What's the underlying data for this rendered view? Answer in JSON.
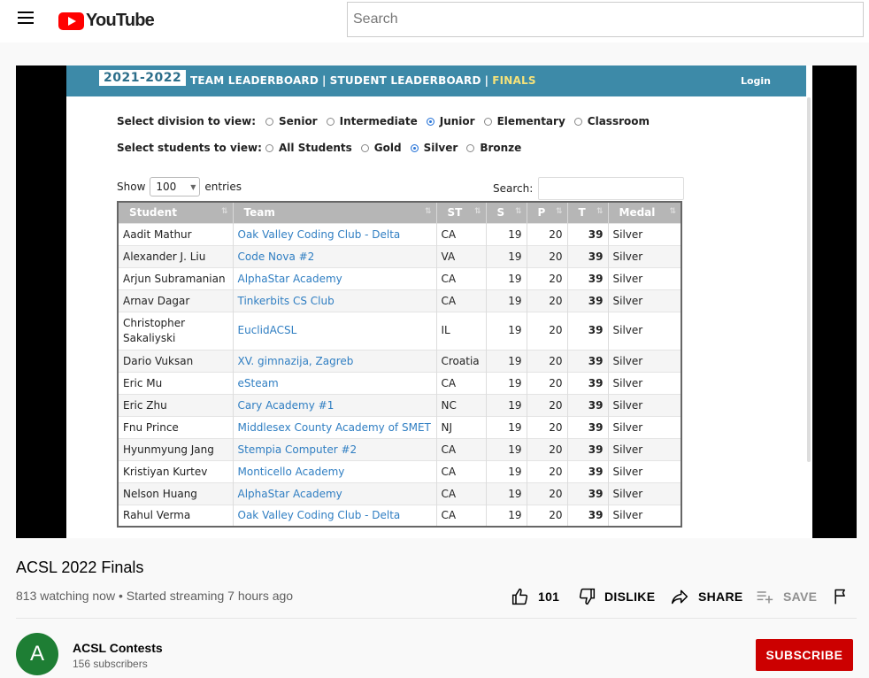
{
  "header": {
    "logo_text": "YouTube",
    "search_placeholder": "Search"
  },
  "video": {
    "acsl": {
      "year": "2021-2022",
      "nav": [
        "TEAM LEADERBOARD",
        "STUDENT LEADERBOARD",
        "FINALS"
      ],
      "login": "Login",
      "division_label": "Select division to view:",
      "divisions": [
        "Senior",
        "Intermediate",
        "Junior",
        "Elementary",
        "Classroom"
      ],
      "division_selected": "Junior",
      "students_label": "Select students to view:",
      "student_filters": [
        "All Students",
        "Gold",
        "Silver",
        "Bronze"
      ],
      "student_selected": "Silver",
      "show_label": "Show",
      "entries_value": "100",
      "entries_label": "entries",
      "search_label": "Search:",
      "columns": [
        "Student",
        "Team",
        "ST",
        "S",
        "P",
        "T",
        "Medal"
      ],
      "rows": [
        [
          "Aadit Mathur",
          "Oak Valley Coding Club - Delta",
          "CA",
          "19",
          "20",
          "39",
          "Silver"
        ],
        [
          "Alexander J. Liu",
          "Code Nova #2",
          "VA",
          "19",
          "20",
          "39",
          "Silver"
        ],
        [
          "Arjun Subramanian",
          "AlphaStar Academy",
          "CA",
          "19",
          "20",
          "39",
          "Silver"
        ],
        [
          "Arnav Dagar",
          "Tinkerbits CS Club",
          "CA",
          "19",
          "20",
          "39",
          "Silver"
        ],
        [
          "Christopher Sakaliyski",
          "EuclidACSL",
          "IL",
          "19",
          "20",
          "39",
          "Silver"
        ],
        [
          "Dario Vuksan",
          "XV. gimnazija, Zagreb",
          "Croatia",
          "19",
          "20",
          "39",
          "Silver"
        ],
        [
          "Eric Mu",
          "eSteam",
          "CA",
          "19",
          "20",
          "39",
          "Silver"
        ],
        [
          "Eric Zhu",
          "Cary Academy #1",
          "NC",
          "19",
          "20",
          "39",
          "Silver"
        ],
        [
          "Fnu Prince",
          "Middlesex County Academy of SMET",
          "NJ",
          "19",
          "20",
          "39",
          "Silver"
        ],
        [
          "Hyunmyung Jang",
          "Stempia Computer #2",
          "CA",
          "19",
          "20",
          "39",
          "Silver"
        ],
        [
          "Kristiyan Kurtev",
          "Monticello Academy",
          "CA",
          "19",
          "20",
          "39",
          "Silver"
        ],
        [
          "Nelson Huang",
          "AlphaStar Academy",
          "CA",
          "19",
          "20",
          "39",
          "Silver"
        ],
        [
          "Rahul Verma",
          "Oak Valley Coding Club - Delta",
          "CA",
          "19",
          "20",
          "39",
          "Silver"
        ]
      ]
    }
  },
  "info": {
    "title": "ACSL 2022 Finals",
    "meta": "813 watching now • Started streaming 7 hours ago",
    "like_count": "101",
    "dislike_label": "DISLIKE",
    "share_label": "SHARE",
    "save_label": "SAVE"
  },
  "channel": {
    "avatar_letter": "A",
    "name": "ACSL Contests",
    "subscribers": "156 subscribers",
    "subscribe_label": "SUBSCRIBE"
  },
  "colors": {
    "brand_red": "#ff0000",
    "subscribe_red": "#cc0000",
    "avatar_green": "#1e7e34",
    "acsl_bar": "#3d8aa8",
    "link_blue": "#2f7ec2"
  }
}
